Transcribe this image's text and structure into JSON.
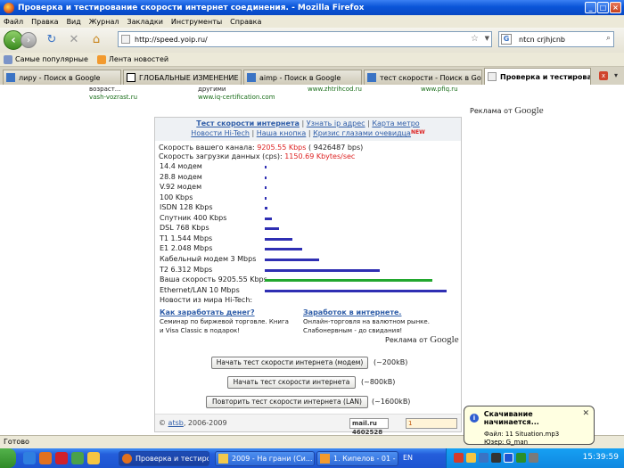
{
  "window": {
    "title": "Проверка и тестирование скорости интернет соединения. - Mozilla Firefox"
  },
  "menu": [
    "Файл",
    "Правка",
    "Вид",
    "Журнал",
    "Закладки",
    "Инструменты",
    "Справка"
  ],
  "nav": {
    "url": "http://speed.yoip.ru/",
    "search_value": "ntcn crjhjcnb"
  },
  "bookmarks": [
    "Самые популярные",
    "Лента новостей"
  ],
  "tabs": [
    {
      "label": "лиру - Поиск в Google",
      "active": false
    },
    {
      "label": "ГЛОБАЛЬНЫЕ ИЗМЕНЕНИЕ ...",
      "active": false
    },
    {
      "label": "aimp - Поиск в Google",
      "active": false
    },
    {
      "label": "тест скорости - Поиск в Go...",
      "active": false
    },
    {
      "label": "Проверка и тестирован...",
      "active": true
    }
  ],
  "top_ads": {
    "a1": "возраст...",
    "a2": "vash-vozrast.ru",
    "b1": "другими",
    "b2": "www.iq-certification.com",
    "c1": "www.zhtrihcod.ru",
    "d1": "www.pfiq.ru"
  },
  "ads_by": {
    "prefix": "Реклама от",
    "brand": "Google"
  },
  "links": {
    "l1": "Тест скорости интернета",
    "l2": "Узнать ip адрес",
    "l3": "Карта метро",
    "l4": "Новости Hi-Tech",
    "l5": "Наша кнопка",
    "l6": "Кризис глазами очевидца",
    "new": "NEW"
  },
  "speed": {
    "channel_label": "Скорость вашего канала:",
    "channel_value": "9205.55 Kbps",
    "channel_bps": "( 9426487 bps)",
    "download_label": "Скорость загрузки данных (cps):",
    "download_value": "1150.69 Kbytes/sec"
  },
  "chart_data": {
    "type": "bar",
    "categories": [
      "14.4 модем",
      "28.8 модем",
      "V.92 модем",
      "100 Kbps",
      "ISDN 128 Kbps",
      "Спутник 400 Kbps",
      "DSL 768 Kbps",
      "T1 1.544 Mbps",
      "E1 2.048 Mbps",
      "Кабельный модем 3 Mbps",
      "T2 6.312 Mbps",
      "Ваша скорость 9205.55 Kbps",
      "Ethernet/LAN 10 Mbps"
    ],
    "values": [
      14.4,
      28.8,
      56,
      100,
      128,
      400,
      768,
      1544,
      2048,
      3000,
      6312,
      9205.55,
      10000
    ],
    "highlight_index": 11,
    "colors": {
      "bar": "#2f2fb3",
      "highlight": "#22a72e"
    }
  },
  "news_label": "Новости из мира Hi-Tech:",
  "ad_cols": {
    "left_h": "Как заработать денег?",
    "left_1": "Семинар по биржевой торговле. Книга",
    "left_2": "и Visa Classic в подарок!",
    "right_h": "Заработок в интернете.",
    "right_1": "Онлайн-торговля на валютном рынке.",
    "right_2": "Слабонервным - до свидания!"
  },
  "buttons": [
    {
      "label": "Начать тест скорости интернета (модем)",
      "size": "(~200kB)"
    },
    {
      "label": "Начать тест скорости интернета",
      "size": "(~800kB)"
    },
    {
      "label": "Повторить тест скорости интернета (LAN)",
      "size": "(~1600kB)"
    }
  ],
  "footer": {
    "copy_prefix": "©",
    "copy_link": "atsb",
    "copy_suffix": ", 2006-2009",
    "counter": "mail.ru 4602528",
    "counter2": "1"
  },
  "status": "Готово",
  "notification": {
    "title": "Скачивание начинается...",
    "line1": "Файл: 11  Situation.mp3",
    "line2": "Юзер: G_man"
  },
  "taskbar": {
    "tasks": [
      "Проверка и тестиро...",
      "2009 - На грани (Си...",
      "1. Кипелов - 01 - На ..."
    ],
    "lang": "EN",
    "clock": "15:39:59"
  }
}
